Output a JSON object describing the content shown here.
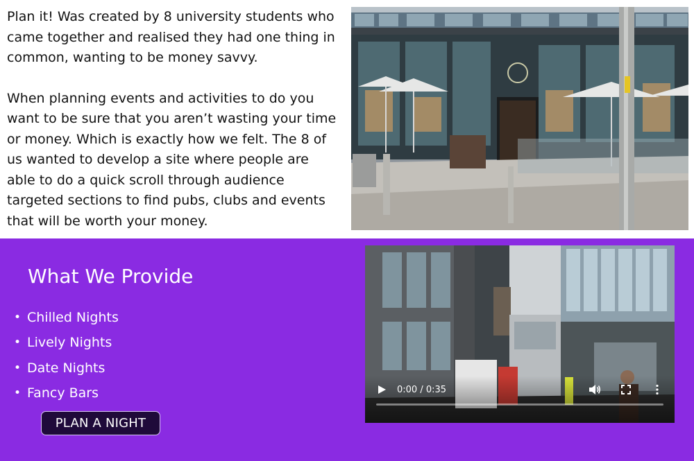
{
  "about": {
    "paragraph1": "Plan it! Was created by 8 university students who came together and realised they had one thing in common, wanting to be money savvy.",
    "paragraph2": "When planning events and activities to do you want to be sure that you aren’t wasting your time or money. Which is exactly how we felt. The 8 of us wanted to develop a site where people are able to do a quick scroll through audience targeted sections to find pubs, clubs and events that will be worth your money."
  },
  "provide": {
    "title": "What We Provide",
    "items": [
      "Chilled Nights",
      "Lively Nights",
      "Date Nights",
      "Fancy Bars"
    ],
    "button_label": "PLAN A NIGHT"
  },
  "video": {
    "time_label": "0:00 / 0:35",
    "progress": 0
  },
  "colors": {
    "purple": "#8a2be2",
    "button_bg": "#1f0a3a"
  }
}
